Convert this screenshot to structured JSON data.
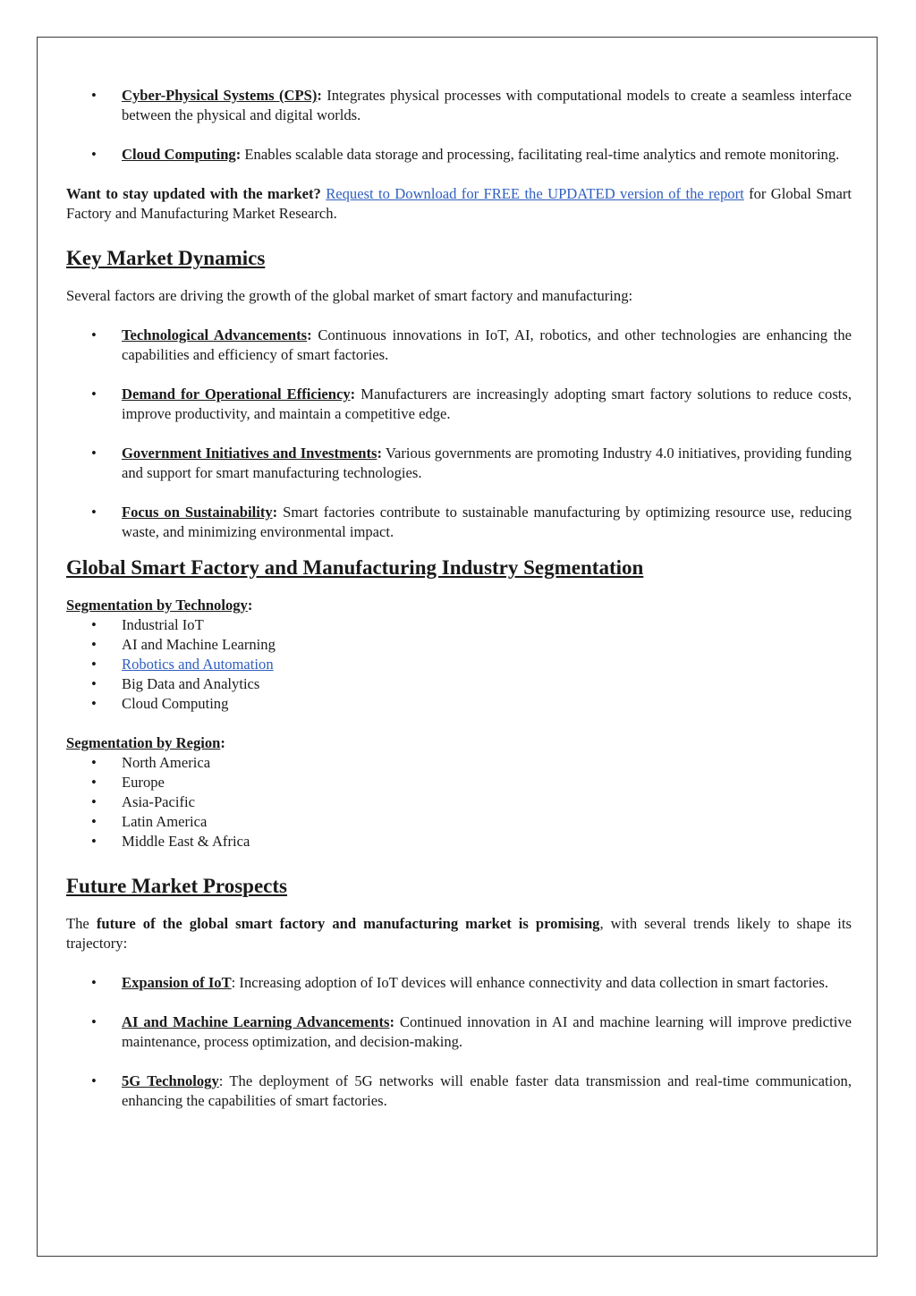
{
  "intro_bullets": [
    {
      "term": "Cyber-Physical Systems (CPS)",
      "text": " Integrates physical processes with computational models to create a seamless interface between the physical and digital worlds."
    },
    {
      "term": "Cloud Computing",
      "text": " Enables scalable data storage and processing, facilitating real-time analytics and remote monitoring."
    }
  ],
  "cta": {
    "lead": "Want to stay updated with the market?",
    "link_text": "Request to Download for FREE the UPDATED version of the report",
    "tail": " for Global Smart Factory and Manufacturing Market Research."
  },
  "dynamics": {
    "heading": "Key Market Dynamics",
    "intro": "Several factors are driving the growth of the global market of smart factory and manufacturing:",
    "bullets": [
      {
        "term": "Technological Advancements",
        "text": " Continuous innovations in IoT, AI, robotics, and other technologies are enhancing the capabilities and efficiency of smart factories."
      },
      {
        "term": "Demand for Operational Efficiency",
        "text": " Manufacturers are increasingly adopting smart factory solutions to reduce costs, improve productivity, and maintain a competitive edge."
      },
      {
        "term": "Government Initiatives and Investments",
        "text": " Various governments are promoting Industry 4.0 initiatives, providing funding and support for smart manufacturing technologies."
      },
      {
        "term": "Focus on Sustainability",
        "text": " Smart factories contribute to sustainable manufacturing by optimizing resource use, reducing waste, and minimizing environmental impact."
      }
    ]
  },
  "segmentation": {
    "heading": "Global Smart Factory and Manufacturing Industry Segmentation",
    "technology": {
      "label": "Segmentation by Technology",
      "items": [
        "Industrial IoT",
        "AI and Machine Learning",
        "Robotics and Automation",
        "Big Data and Analytics",
        "Cloud Computing"
      ],
      "linked_item": "Robotics and Automation"
    },
    "region": {
      "label": "Segmentation by Region",
      "items": [
        "North America",
        "Europe",
        "Asia-Pacific",
        "Latin America",
        "Middle East & Africa"
      ]
    }
  },
  "future": {
    "heading": "Future Market Prospects",
    "intro_pre": "The ",
    "intro_bold": "future of the global smart factory and manufacturing market is promising",
    "intro_post": ", with several trends likely to shape its trajectory:",
    "bullets": [
      {
        "term": "Expansion of IoT",
        "text": " Increasing adoption of IoT devices will enhance connectivity and data collection in smart factories."
      },
      {
        "term": "AI and Machine Learning Advancements",
        "text": " Continued innovation in AI and machine learning will improve predictive maintenance, process optimization, and decision-making."
      },
      {
        "term": "5G Technology",
        "text": " The deployment of 5G networks will enable faster data transmission and real-time communication, enhancing the capabilities of smart factories."
      }
    ]
  },
  "colors": {
    "link": "#2f5fbf",
    "text": "#1a1a1a",
    "border": "#3a3a3a"
  }
}
